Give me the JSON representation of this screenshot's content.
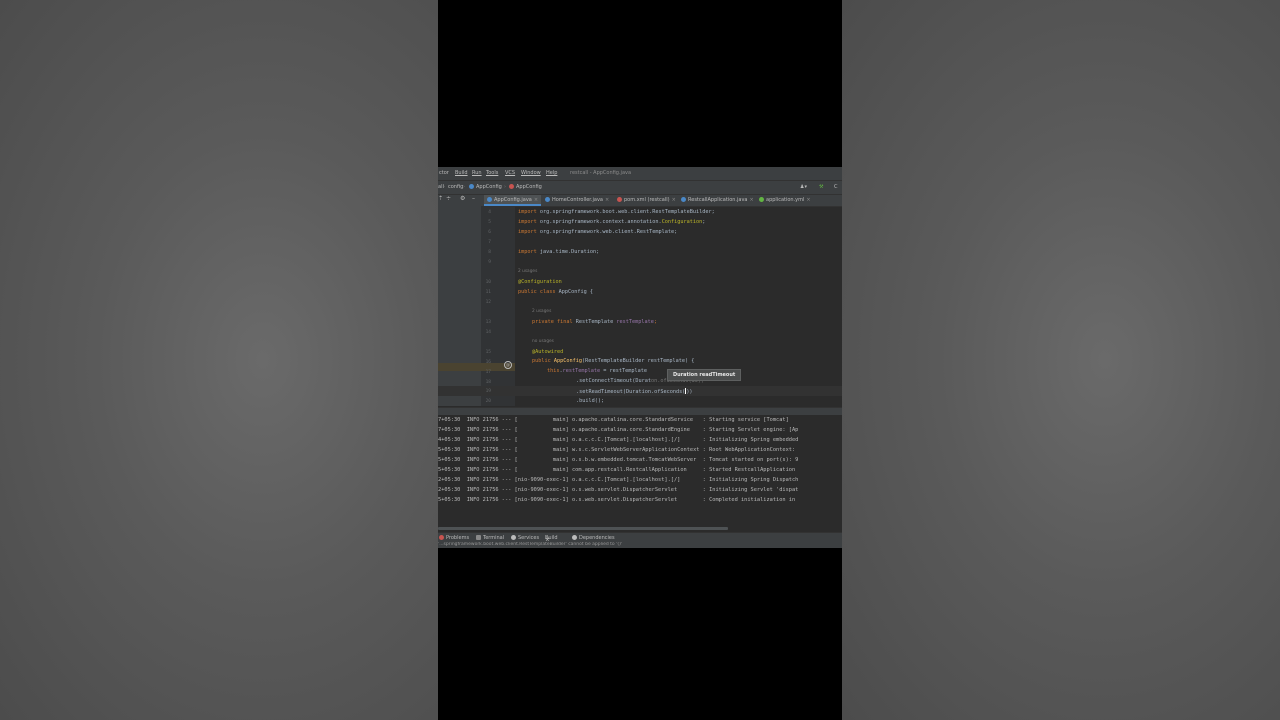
{
  "window": {
    "title": "restcall - AppConfig.java"
  },
  "menu": {
    "items": [
      "ctor",
      "Build",
      "Run",
      "Tools",
      "VCS",
      "Window",
      "Help"
    ]
  },
  "breadcrumb": {
    "items": [
      "all",
      "config",
      "AppConfig",
      "AppConfig"
    ]
  },
  "tabs": [
    {
      "label": "AppConfig.java",
      "icon": "java-class-icon",
      "color": "#4a88c7",
      "active": true
    },
    {
      "label": "HomeController.java",
      "icon": "java-class-icon",
      "color": "#4a88c7",
      "active": false
    },
    {
      "label": "pom.xml (restcall)",
      "icon": "maven-icon",
      "color": "#c75450",
      "active": false
    },
    {
      "label": "RestcallApplication.java",
      "icon": "java-class-icon",
      "color": "#4a88c7",
      "active": false
    },
    {
      "label": "application.yml",
      "icon": "yaml-icon",
      "color": "#62b543",
      "active": false
    }
  ],
  "editor": {
    "line_numbers": [
      "4",
      "5",
      "6",
      "7",
      "8",
      "9",
      "10",
      "11",
      "12",
      "13",
      "14",
      "15",
      "16",
      "17",
      "18",
      "19",
      "20"
    ],
    "lines": {
      "l4": [
        "import",
        " org.springframework.boot.web.client.RestTemplateBuilder;"
      ],
      "l5": [
        "import",
        " org.springframework.context.annotation.",
        "Configuration",
        ";"
      ],
      "l6": [
        "import",
        " org.springframework.web.client.RestTemplate;"
      ],
      "l8": [
        "import",
        " java.time.Duration;"
      ],
      "usages1": "2 usages",
      "l10": "@Configuration",
      "l11": [
        "public class",
        " AppConfig {"
      ],
      "usages2": "2 usages",
      "l13": [
        "private final",
        " RestTemplate ",
        "restTemplate",
        ";"
      ],
      "usages3": "no usages",
      "l15": "@Autowired",
      "l16": [
        "public",
        " ",
        "AppConfig",
        "(RestTemplateBuilder restTemplate) {"
      ],
      "l17": [
        "this",
        ".",
        "restTemplate",
        " = restTemplate"
      ],
      "l18": ".setConnectTimeout(Durat",
      "l18b": "on.ofSeconds(30))",
      "l19": ".setReadTimeout(Duration.ofSeconds(",
      "l19b": "))",
      "l20": ".build();"
    },
    "tooltip": "Duration readTimeout"
  },
  "console": {
    "lines": [
      "7+05:30  INFO 21756 --- [           main] o.apache.catalina.core.StandardService   : Starting service [Tomcat]",
      "7+05:30  INFO 21756 --- [           main] o.apache.catalina.core.StandardEngine    : Starting Servlet engine: [Ap",
      "4+05:30  INFO 21756 --- [           main] o.a.c.c.C.[Tomcat].[localhost].[/]       : Initializing Spring embedded",
      "5+05:30  INFO 21756 --- [           main] w.s.c.ServletWebServerApplicationContext : Root WebApplicationContext:",
      "5+05:30  INFO 21756 --- [           main] o.s.b.w.embedded.tomcat.TomcatWebServer  : Tomcat started on port(s): 9",
      "5+05:30  INFO 21756 --- [           main] com.app.restcall.RestcallApplication     : Started RestcallApplication",
      "2+05:30  INFO 21756 --- [nio-9090-exec-1] o.a.c.c.C.[Tomcat].[localhost].[/]       : Initializing Spring Dispatch",
      "2+05:30  INFO 21756 --- [nio-9090-exec-1] o.s.web.servlet.DispatcherServlet        : Initializing Servlet 'dispat",
      "5+05:30  INFO 21756 --- [nio-9090-exec-1] o.s.web.servlet.DispatcherServlet        : Completed initialization in"
    ]
  },
  "toolwindows": [
    {
      "label": "Problems",
      "icon": "problems-icon"
    },
    {
      "label": "Terminal",
      "icon": "terminal-icon"
    },
    {
      "label": "Services",
      "icon": "services-icon"
    },
    {
      "label": "Build",
      "icon": "hammer-icon"
    },
    {
      "label": "Dependencies",
      "icon": "dependencies-icon"
    }
  ],
  "status": {
    "message": "'...springframework.boot.web.client.RestTemplateBuilder' cannot be applied to '()'"
  },
  "colors": {
    "keyword": "#cc7832",
    "annotation": "#bbb529",
    "field": "#9876aa",
    "method": "#ffc66d",
    "tooltip_bg": "#4b4d4d"
  }
}
